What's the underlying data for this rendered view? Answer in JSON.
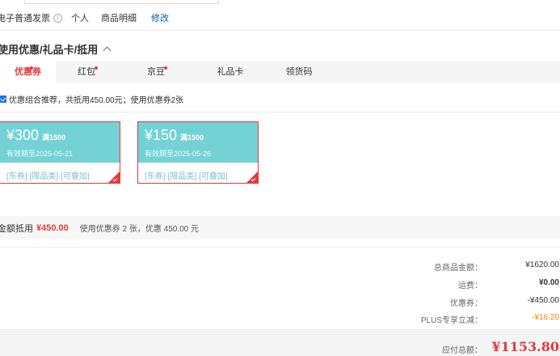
{
  "invoice": {
    "type": "电子普通发票",
    "info_icon": "i",
    "personal": "个人",
    "detail": "商品明细",
    "edit": "修改"
  },
  "section": {
    "title": "使用优惠/礼品卡/抵用",
    "toggle_icon": "chevron-up-icon"
  },
  "tabs": [
    {
      "label": "优惠券",
      "active": true,
      "dot": true
    },
    {
      "label": "红包",
      "active": false,
      "dot": true
    },
    {
      "label": "京豆",
      "active": false,
      "dot": true
    },
    {
      "label": "礼品卡",
      "active": false,
      "dot": false
    },
    {
      "label": "领货码",
      "active": false,
      "dot": false
    }
  ],
  "recommend": {
    "checked": true,
    "text": "优惠组合推荐，共抵用450.00元；使用优惠券2张"
  },
  "coupons": [
    {
      "amount": "¥300",
      "condition": "满1500",
      "expire": "有效期至2025-05-21",
      "tags": [
        "[东券]",
        "[限品类]",
        "[可叠加]"
      ],
      "selected": true
    },
    {
      "amount": "¥150",
      "condition": "满1500",
      "expire": "有效期至2025-05-26",
      "tags": [
        "[东券]",
        "[限品类]",
        "[可叠加]"
      ],
      "selected": true
    }
  ],
  "summary": {
    "label": "金额抵用",
    "amount": "¥450.00",
    "desc": "使用优惠券 2 张，优惠 450.00 元"
  },
  "totals": [
    {
      "label": "总商品金额：",
      "value": "¥1620.00",
      "style": ""
    },
    {
      "label": "运费：",
      "value": "¥0.00",
      "style": "bold"
    },
    {
      "label": "优惠券：",
      "value": "-¥450.00",
      "style": ""
    },
    {
      "label": "PLUS专享立减：",
      "value": "-¥16.20",
      "style": "orange"
    }
  ],
  "pay": {
    "label": "应付总额：",
    "amount": "¥1153.80"
  },
  "colors": {
    "accent": "#e4393c",
    "coupon_bg": "#74d2d4",
    "link": "#005ea7",
    "plus": "#ff7e00"
  }
}
